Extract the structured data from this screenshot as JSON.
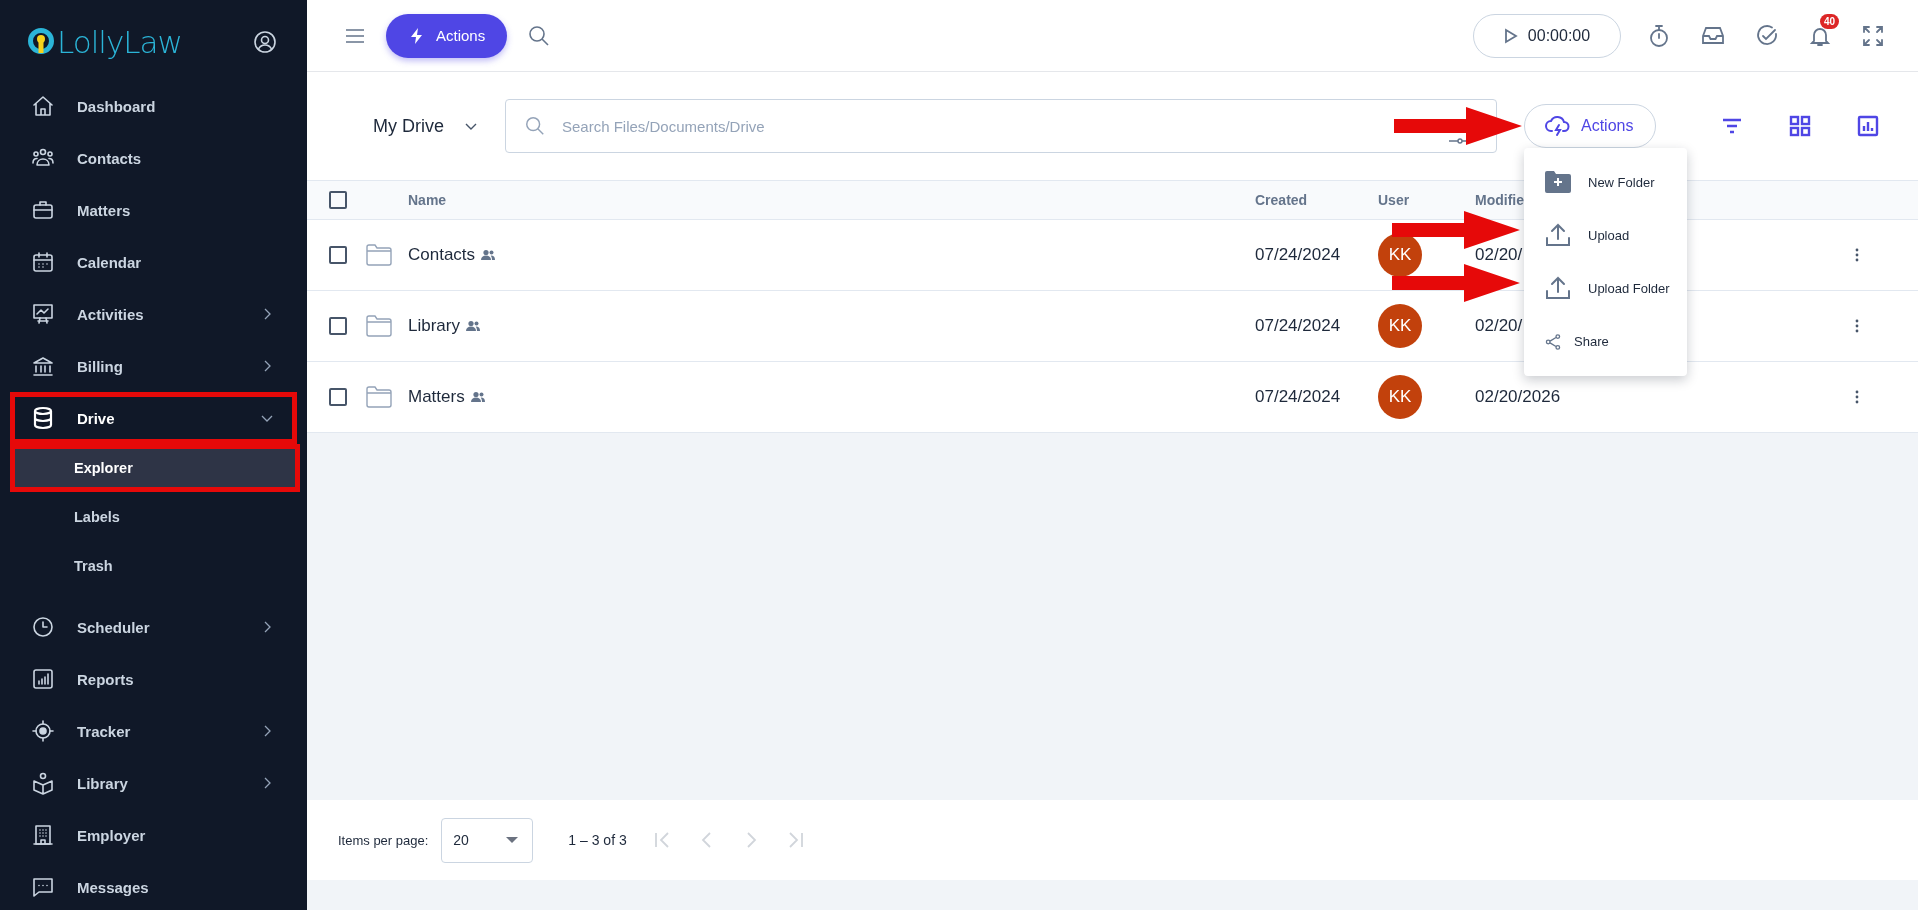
{
  "sidebar": {
    "logo": "LollyLaw",
    "items": [
      {
        "label": "Dashboard",
        "kind": "link",
        "selected": false,
        "annotated": false
      },
      {
        "label": "Contacts",
        "kind": "link",
        "selected": false,
        "annotated": false
      },
      {
        "label": "Matters",
        "kind": "link",
        "selected": false,
        "annotated": false
      },
      {
        "label": "Calendar",
        "kind": "link",
        "selected": false,
        "annotated": false
      },
      {
        "label": "Activities",
        "kind": "group",
        "expanded": false,
        "selected": false,
        "annotated": false
      },
      {
        "label": "Billing",
        "kind": "group",
        "expanded": false,
        "selected": false,
        "annotated": false
      },
      {
        "label": "Drive",
        "kind": "group",
        "expanded": true,
        "selected": false,
        "annotated": true,
        "children": [
          {
            "label": "Explorer",
            "selected": true,
            "annotated": true
          },
          {
            "label": "Labels",
            "selected": false,
            "annotated": false
          },
          {
            "label": "Trash",
            "selected": false,
            "annotated": false
          }
        ]
      },
      {
        "label": "Scheduler",
        "kind": "group",
        "expanded": false,
        "selected": false,
        "annotated": false
      },
      {
        "label": "Reports",
        "kind": "link",
        "selected": false,
        "annotated": false
      },
      {
        "label": "Tracker",
        "kind": "group",
        "expanded": false,
        "selected": false,
        "annotated": false
      },
      {
        "label": "Library",
        "kind": "group",
        "expanded": false,
        "selected": false,
        "annotated": false
      },
      {
        "label": "Employer",
        "kind": "link",
        "selected": false,
        "annotated": false
      },
      {
        "label": "Messages",
        "kind": "link",
        "selected": false,
        "annotated": false
      }
    ]
  },
  "topbar": {
    "actions_label": "Actions",
    "timer": "00:00:00",
    "notifications_badge": "40"
  },
  "toolbar": {
    "drive_select": "My Drive",
    "search_placeholder": "Search Files/Documents/Drive",
    "actions": {
      "label": "Actions",
      "expanded": true,
      "annotated": true
    },
    "menu": [
      {
        "label": "New Folder",
        "annotated": false
      },
      {
        "label": "Upload",
        "annotated": true
      },
      {
        "label": "Upload Folder",
        "annotated": true
      },
      {
        "label": "Share",
        "annotated": false
      }
    ]
  },
  "table": {
    "header_checked": false,
    "columns": [
      "Name",
      "Created",
      "User",
      "Modifie"
    ],
    "rows": [
      {
        "name": "Contacts",
        "shared": true,
        "created": "07/24/2024",
        "user": "KK",
        "modified": "02/20/",
        "checked": false
      },
      {
        "name": "Library",
        "shared": true,
        "created": "07/24/2024",
        "user": "KK",
        "modified": "02/20/",
        "checked": false
      },
      {
        "name": "Matters",
        "shared": true,
        "created": "07/24/2024",
        "user": "KK",
        "modified": "02/20/2026",
        "checked": false
      }
    ]
  },
  "pagination": {
    "label": "Items per page:",
    "page_size": "20",
    "range": "1 – 3 of 3",
    "buttons": [
      {
        "disabled": true
      },
      {
        "disabled": true
      },
      {
        "disabled": true
      },
      {
        "disabled": true
      }
    ]
  }
}
